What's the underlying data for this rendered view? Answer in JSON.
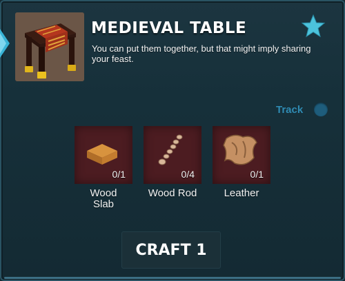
{
  "item": {
    "title": "MEDIEVAL TABLE",
    "description": "You can put them together, but that might imply sharing your feast.",
    "thumbnail_icon": "medieval-table-icon",
    "favorite_icon": "star-icon"
  },
  "track": {
    "label": "Track",
    "enabled": false
  },
  "ingredients": [
    {
      "name": "Wood\nSlab",
      "count": "0/1",
      "icon": "wood-slab-icon"
    },
    {
      "name": "Wood Rod",
      "count": "0/4",
      "icon": "wood-rod-icon"
    },
    {
      "name": "Leather",
      "count": "0/1",
      "icon": "leather-icon"
    }
  ],
  "craft_button": {
    "label": "CRAFT 1"
  },
  "colors": {
    "panel_bg": "#16303a",
    "slot_bg": "#4c1c21",
    "track_blue": "#2f8bb3",
    "star_cyan": "#4cc3dc"
  }
}
